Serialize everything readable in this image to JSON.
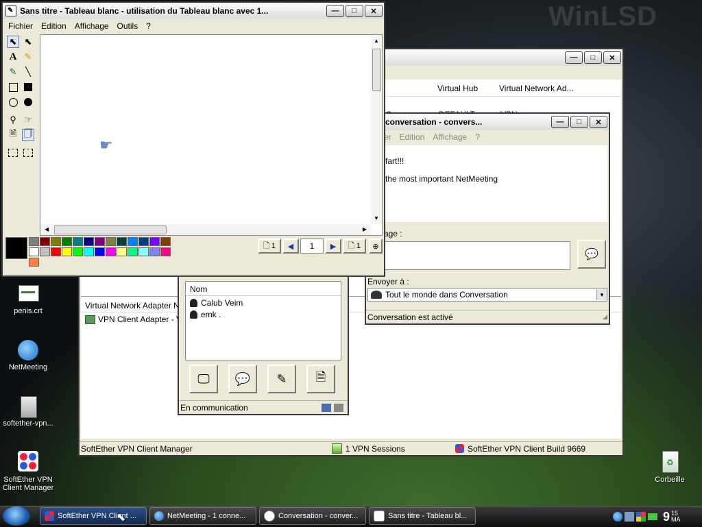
{
  "desktop": {
    "watermark": "WinLSD",
    "icons": [
      {
        "label": "penis.crt"
      },
      {
        "label": "NetMeeting"
      },
      {
        "label": "softether-vpn..."
      },
      {
        "label": "SoftEther VPN Client Manager"
      },
      {
        "label": "Corbeille"
      }
    ]
  },
  "whiteboard": {
    "title": "Sans titre - Tableau blanc - utilisation du Tableau blanc avec 1...",
    "menu": [
      "Fichier",
      "Edition",
      "Affichage",
      "Outils",
      "?"
    ],
    "page_left": "1",
    "page_current": "1",
    "page_right": "1",
    "palette": [
      "#808080",
      "#800000",
      "#808000",
      "#008000",
      "#008080",
      "#000080",
      "#800080",
      "#808040",
      "#004040",
      "#0080ff",
      "#004080",
      "#8000ff",
      "#804000",
      "#ffffff",
      "#c0c0c0",
      "#ff0000",
      "#ffff00",
      "#00ff00",
      "#00ffff",
      "#0000ff",
      "#ff00ff",
      "#ffff80",
      "#00ff80",
      "#80ffff",
      "#8080ff",
      "#ff0080",
      "#ff8040"
    ]
  },
  "vpn_manager": {
    "col_virtual_hub": "Virtual Hub",
    "col_adapter": "Virtual Network Ad...",
    "row_partial_1": "IP Conne...",
    "row_partial_2": "DEFAULT",
    "row_partial_3": "VPN",
    "adapter_header": "Virtual Network Adapter N",
    "adapter_row": "VPN Client Adapter - VP",
    "status_left": "SoftEther VPN Client Manager",
    "status_sessions": "1 VPN Sessions",
    "status_build": "SoftEther VPN Client Build 9669"
  },
  "netmeeting": {
    "list_header": "Nom",
    "participants": [
      "Calub Veim",
      "emk ."
    ],
    "status": "En communication"
  },
  "chat": {
    "title": "conversation - convers...",
    "menu": [
      "er",
      "Edition",
      "Affichage",
      "?"
    ],
    "messages": [
      "fart!!!",
      "the most important NetMeeting"
    ],
    "message_label": "age :",
    "send_to_label": "Envoyer à :",
    "send_to_value": "Tout le monde dans Conversation",
    "status": "Conversation est activé"
  },
  "taskbar": {
    "tasks": [
      {
        "label": "SoftEther VPN Client ..."
      },
      {
        "label": "NetMeeting - 1 conne..."
      },
      {
        "label": "Conversation - conver..."
      },
      {
        "label": "Sans titre - Tableau bl..."
      }
    ],
    "clock_hour": "9",
    "clock_min": "15",
    "clock_ampm": "MA"
  }
}
